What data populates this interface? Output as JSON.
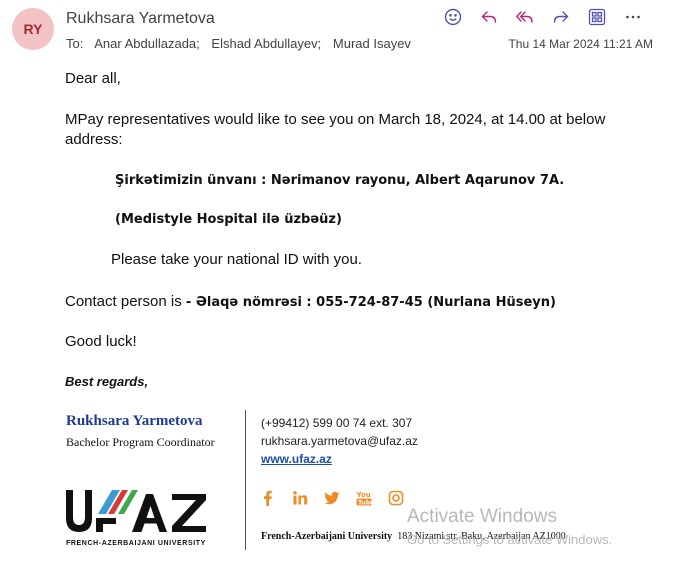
{
  "header": {
    "avatar_initials": "RY",
    "sender": "Rukhsara Yarmetova",
    "to_label": "To:",
    "recipients": [
      "Anar Abdullazada;",
      "Elshad Abdullayev;",
      "Murad Isayev"
    ],
    "date": "Thu 14 Mar 2024 11:21 AM",
    "toolbar": [
      "emoji-icon",
      "reply-icon",
      "reply-all-icon",
      "forward-icon",
      "apps-icon",
      "more-icon"
    ]
  },
  "body": {
    "greeting": "Dear all,",
    "mpay": "MPay representatives would like to see you on March 18, 2024, at 14.00 at below address:",
    "address_line1": "Şirkətimizin ünvanı :  Nərimanov rayonu, Albert Aqarunov 7A.",
    "address_line2": "(Medistyle Hospital ilə üzbəüz)",
    "national_id": "Please take your national ID with you.",
    "contact_prefix": "Contact person is ",
    "contact_detail": " - Əlaqə nömrəsi :  055-724-87-45 (Nurlana Hüseyn)",
    "good_luck": "Good luck!",
    "regards": "Best regards,"
  },
  "signature": {
    "name": "Rukhsara Yarmetova",
    "title": "Bachelor Program Coordinator",
    "phone": "(+99412) 599 00 74 ext. 307",
    "email": "rukhsara.yarmetova@ufaz.az",
    "website": "www.ufaz.az",
    "logo_caption": "FRENCH-AZERBAIJANI UNIVERSITY",
    "university": "French-Azerbaijani University",
    "address": "183 Nizami str. Baku, Azerbaijan AZ1000",
    "socials": [
      "facebook-icon",
      "linkedin-icon",
      "twitter-icon",
      "youtube-icon",
      "instagram-icon"
    ]
  },
  "watermark": {
    "title": "Activate Windows",
    "subtitle": "Go to Settings to activate Windows."
  },
  "colors": {
    "accent": "#4f52b2",
    "social": "#f08a24",
    "sig_name": "#1f3a93"
  }
}
